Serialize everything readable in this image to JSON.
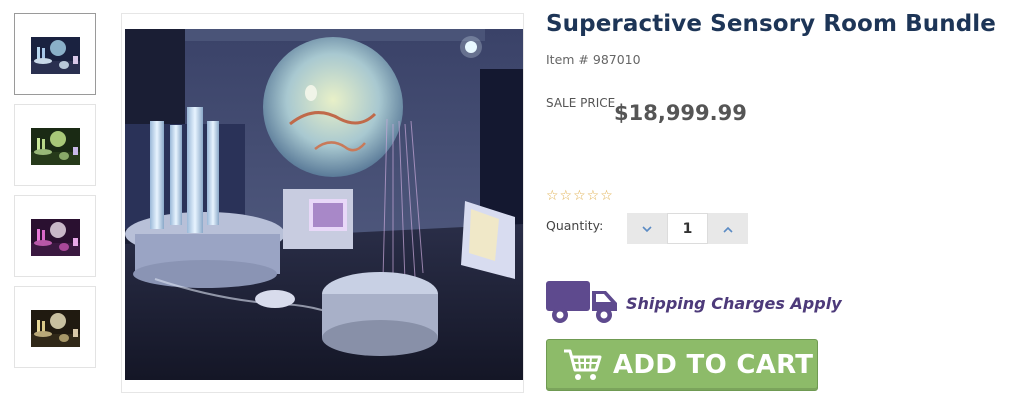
{
  "product": {
    "title": "Superactive Sensory Room Bundle",
    "item_number": "Item # 987010",
    "sale_price_label": "SALE PRICE",
    "price": "$18,999.99",
    "rating_stars": "☆☆☆☆☆",
    "quantity_label": "Quantity:",
    "quantity_value": "1",
    "shipping_text": "Shipping Charges Apply",
    "add_to_cart_label": "ADD TO CART"
  },
  "thumbnails": [
    {
      "name": "thumbnail-1",
      "tint": "#3a5a8a"
    },
    {
      "name": "thumbnail-2",
      "tint": "#4e8a3a"
    },
    {
      "name": "thumbnail-3",
      "tint": "#8a3a8a"
    },
    {
      "name": "thumbnail-4",
      "tint": "#8a6a2a"
    }
  ],
  "colors": {
    "title": "#1d3557",
    "shipping": "#4d3a7a",
    "add_to_cart_bg": "#8dbb69",
    "quantity_arrow": "#5b8bc4",
    "stars": "#e0b050"
  },
  "icons": {
    "qty_decrease": "chevron-down-icon",
    "qty_increase": "chevron-up-icon",
    "shipping": "truck-icon",
    "cart": "shopping-cart-icon"
  }
}
